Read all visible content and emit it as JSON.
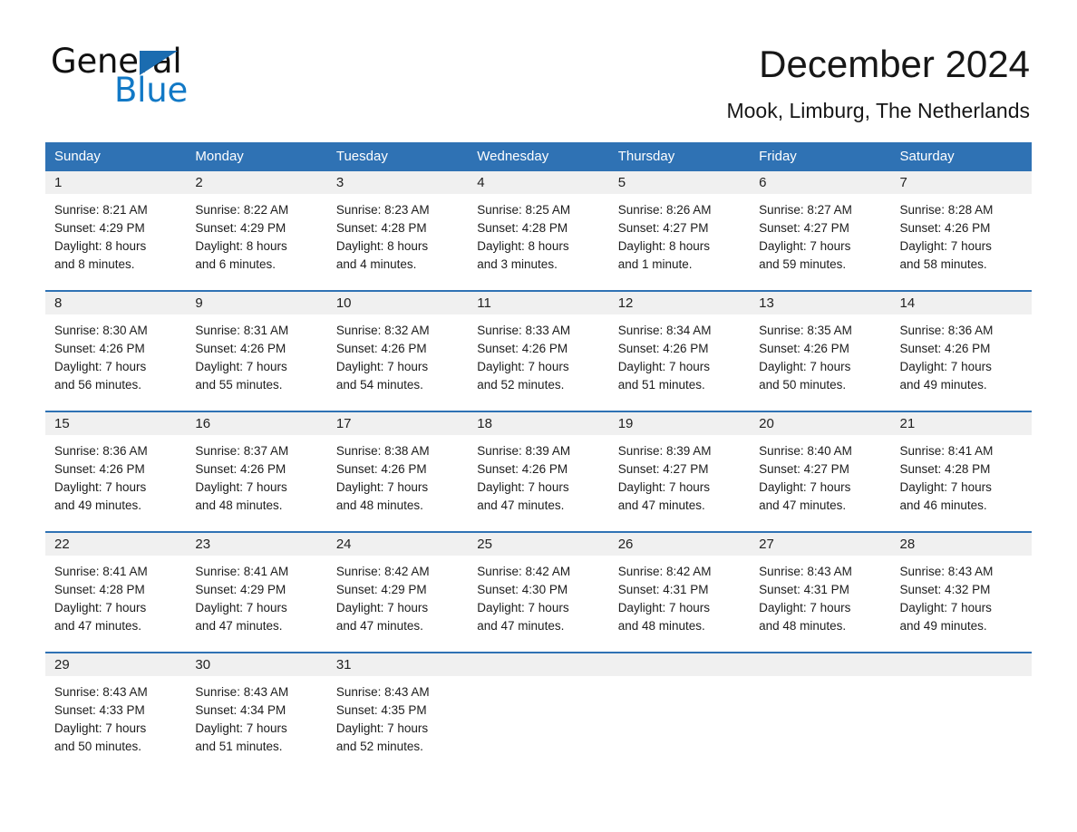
{
  "brand": {
    "name_part1": "General",
    "name_part2": "Blue",
    "logo_icon": "blue-triangle-icon",
    "accent_color": "#2f72b4",
    "header_blue": "#2f72b4",
    "daynum_band_color": "#f0f0f0"
  },
  "header": {
    "title": "December 2024",
    "subtitle": "Mook, Limburg, The Netherlands"
  },
  "calendar": {
    "weekday_headers": [
      "Sunday",
      "Monday",
      "Tuesday",
      "Wednesday",
      "Thursday",
      "Friday",
      "Saturday"
    ],
    "weeks": [
      [
        {
          "day": "1",
          "sunrise": "Sunrise: 8:21 AM",
          "sunset": "Sunset: 4:29 PM",
          "daylight_line1": "Daylight: 8 hours",
          "daylight_line2": "and 8 minutes."
        },
        {
          "day": "2",
          "sunrise": "Sunrise: 8:22 AM",
          "sunset": "Sunset: 4:29 PM",
          "daylight_line1": "Daylight: 8 hours",
          "daylight_line2": "and 6 minutes."
        },
        {
          "day": "3",
          "sunrise": "Sunrise: 8:23 AM",
          "sunset": "Sunset: 4:28 PM",
          "daylight_line1": "Daylight: 8 hours",
          "daylight_line2": "and 4 minutes."
        },
        {
          "day": "4",
          "sunrise": "Sunrise: 8:25 AM",
          "sunset": "Sunset: 4:28 PM",
          "daylight_line1": "Daylight: 8 hours",
          "daylight_line2": "and 3 minutes."
        },
        {
          "day": "5",
          "sunrise": "Sunrise: 8:26 AM",
          "sunset": "Sunset: 4:27 PM",
          "daylight_line1": "Daylight: 8 hours",
          "daylight_line2": "and 1 minute."
        },
        {
          "day": "6",
          "sunrise": "Sunrise: 8:27 AM",
          "sunset": "Sunset: 4:27 PM",
          "daylight_line1": "Daylight: 7 hours",
          "daylight_line2": "and 59 minutes."
        },
        {
          "day": "7",
          "sunrise": "Sunrise: 8:28 AM",
          "sunset": "Sunset: 4:26 PM",
          "daylight_line1": "Daylight: 7 hours",
          "daylight_line2": "and 58 minutes."
        }
      ],
      [
        {
          "day": "8",
          "sunrise": "Sunrise: 8:30 AM",
          "sunset": "Sunset: 4:26 PM",
          "daylight_line1": "Daylight: 7 hours",
          "daylight_line2": "and 56 minutes."
        },
        {
          "day": "9",
          "sunrise": "Sunrise: 8:31 AM",
          "sunset": "Sunset: 4:26 PM",
          "daylight_line1": "Daylight: 7 hours",
          "daylight_line2": "and 55 minutes."
        },
        {
          "day": "10",
          "sunrise": "Sunrise: 8:32 AM",
          "sunset": "Sunset: 4:26 PM",
          "daylight_line1": "Daylight: 7 hours",
          "daylight_line2": "and 54 minutes."
        },
        {
          "day": "11",
          "sunrise": "Sunrise: 8:33 AM",
          "sunset": "Sunset: 4:26 PM",
          "daylight_line1": "Daylight: 7 hours",
          "daylight_line2": "and 52 minutes."
        },
        {
          "day": "12",
          "sunrise": "Sunrise: 8:34 AM",
          "sunset": "Sunset: 4:26 PM",
          "daylight_line1": "Daylight: 7 hours",
          "daylight_line2": "and 51 minutes."
        },
        {
          "day": "13",
          "sunrise": "Sunrise: 8:35 AM",
          "sunset": "Sunset: 4:26 PM",
          "daylight_line1": "Daylight: 7 hours",
          "daylight_line2": "and 50 minutes."
        },
        {
          "day": "14",
          "sunrise": "Sunrise: 8:36 AM",
          "sunset": "Sunset: 4:26 PM",
          "daylight_line1": "Daylight: 7 hours",
          "daylight_line2": "and 49 minutes."
        }
      ],
      [
        {
          "day": "15",
          "sunrise": "Sunrise: 8:36 AM",
          "sunset": "Sunset: 4:26 PM",
          "daylight_line1": "Daylight: 7 hours",
          "daylight_line2": "and 49 minutes."
        },
        {
          "day": "16",
          "sunrise": "Sunrise: 8:37 AM",
          "sunset": "Sunset: 4:26 PM",
          "daylight_line1": "Daylight: 7 hours",
          "daylight_line2": "and 48 minutes."
        },
        {
          "day": "17",
          "sunrise": "Sunrise: 8:38 AM",
          "sunset": "Sunset: 4:26 PM",
          "daylight_line1": "Daylight: 7 hours",
          "daylight_line2": "and 48 minutes."
        },
        {
          "day": "18",
          "sunrise": "Sunrise: 8:39 AM",
          "sunset": "Sunset: 4:26 PM",
          "daylight_line1": "Daylight: 7 hours",
          "daylight_line2": "and 47 minutes."
        },
        {
          "day": "19",
          "sunrise": "Sunrise: 8:39 AM",
          "sunset": "Sunset: 4:27 PM",
          "daylight_line1": "Daylight: 7 hours",
          "daylight_line2": "and 47 minutes."
        },
        {
          "day": "20",
          "sunrise": "Sunrise: 8:40 AM",
          "sunset": "Sunset: 4:27 PM",
          "daylight_line1": "Daylight: 7 hours",
          "daylight_line2": "and 47 minutes."
        },
        {
          "day": "21",
          "sunrise": "Sunrise: 8:41 AM",
          "sunset": "Sunset: 4:28 PM",
          "daylight_line1": "Daylight: 7 hours",
          "daylight_line2": "and 46 minutes."
        }
      ],
      [
        {
          "day": "22",
          "sunrise": "Sunrise: 8:41 AM",
          "sunset": "Sunset: 4:28 PM",
          "daylight_line1": "Daylight: 7 hours",
          "daylight_line2": "and 47 minutes."
        },
        {
          "day": "23",
          "sunrise": "Sunrise: 8:41 AM",
          "sunset": "Sunset: 4:29 PM",
          "daylight_line1": "Daylight: 7 hours",
          "daylight_line2": "and 47 minutes."
        },
        {
          "day": "24",
          "sunrise": "Sunrise: 8:42 AM",
          "sunset": "Sunset: 4:29 PM",
          "daylight_line1": "Daylight: 7 hours",
          "daylight_line2": "and 47 minutes."
        },
        {
          "day": "25",
          "sunrise": "Sunrise: 8:42 AM",
          "sunset": "Sunset: 4:30 PM",
          "daylight_line1": "Daylight: 7 hours",
          "daylight_line2": "and 47 minutes."
        },
        {
          "day": "26",
          "sunrise": "Sunrise: 8:42 AM",
          "sunset": "Sunset: 4:31 PM",
          "daylight_line1": "Daylight: 7 hours",
          "daylight_line2": "and 48 minutes."
        },
        {
          "day": "27",
          "sunrise": "Sunrise: 8:43 AM",
          "sunset": "Sunset: 4:31 PM",
          "daylight_line1": "Daylight: 7 hours",
          "daylight_line2": "and 48 minutes."
        },
        {
          "day": "28",
          "sunrise": "Sunrise: 8:43 AM",
          "sunset": "Sunset: 4:32 PM",
          "daylight_line1": "Daylight: 7 hours",
          "daylight_line2": "and 49 minutes."
        }
      ],
      [
        {
          "day": "29",
          "sunrise": "Sunrise: 8:43 AM",
          "sunset": "Sunset: 4:33 PM",
          "daylight_line1": "Daylight: 7 hours",
          "daylight_line2": "and 50 minutes."
        },
        {
          "day": "30",
          "sunrise": "Sunrise: 8:43 AM",
          "sunset": "Sunset: 4:34 PM",
          "daylight_line1": "Daylight: 7 hours",
          "daylight_line2": "and 51 minutes."
        },
        {
          "day": "31",
          "sunrise": "Sunrise: 8:43 AM",
          "sunset": "Sunset: 4:35 PM",
          "daylight_line1": "Daylight: 7 hours",
          "daylight_line2": "and 52 minutes."
        },
        {
          "day": "",
          "sunrise": "",
          "sunset": "",
          "daylight_line1": "",
          "daylight_line2": ""
        },
        {
          "day": "",
          "sunrise": "",
          "sunset": "",
          "daylight_line1": "",
          "daylight_line2": ""
        },
        {
          "day": "",
          "sunrise": "",
          "sunset": "",
          "daylight_line1": "",
          "daylight_line2": ""
        },
        {
          "day": "",
          "sunrise": "",
          "sunset": "",
          "daylight_line1": "",
          "daylight_line2": ""
        }
      ]
    ]
  }
}
